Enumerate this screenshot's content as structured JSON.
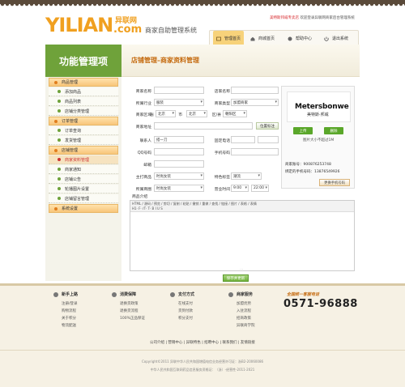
{
  "header": {
    "logo": "YILIAN",
    "logo_cn": "异联网",
    "logo_com": ".com",
    "system_name": "商家自助管理系统",
    "note_red": "美特斯邦威专卖店",
    "note": "欢迎登录异联网商家后台管理系统",
    "nav": [
      {
        "label": "管理首页",
        "icon": "home-gear-icon",
        "active": true
      },
      {
        "label": "商城首页",
        "icon": "house-icon",
        "active": false
      },
      {
        "label": "帮助中心",
        "icon": "help-icon",
        "active": false
      },
      {
        "label": "退出系统",
        "icon": "exit-icon",
        "active": false
      }
    ]
  },
  "sidebar": {
    "title": "功能管理项",
    "groups": [
      {
        "label": "商品管理",
        "items": [
          "添加商品",
          "商品列表",
          "店铺分类管理"
        ]
      },
      {
        "label": "订单管理",
        "items": [
          "订单查询",
          "发货管理"
        ]
      },
      {
        "label": "店铺管理",
        "items": [
          "商家资料管理",
          "商家通知",
          "店铺公告",
          "轮播图片设置",
          "店铺留言管理"
        ]
      },
      {
        "label": "系统设置",
        "items": []
      }
    ],
    "active_item": "商家资料管理"
  },
  "main": {
    "title": "店铺管理–商家资料管理",
    "form": {
      "merchant_name_label": "商家名称",
      "merchant_name": "",
      "shop_name_label": "店家名称",
      "shop_name": "",
      "industry_label": "所属行业",
      "industry": "服装",
      "type_label": "商家类型",
      "type": "加盟商家",
      "region_label": "商家区域",
      "province_label": "省",
      "province": "北京",
      "city_label": "市",
      "city": "北京",
      "district_label": "区/县",
      "district": "朝阳区",
      "address_label": "商家地址",
      "address": "",
      "locate_button": "位置标注",
      "contact_label": "联系人",
      "contact": "搭一刀",
      "phone_label": "固定电话",
      "phone": "",
      "qq_label": "QQ号码",
      "qq": "",
      "mobile_label": "手机号码",
      "mobile": "",
      "email_label": "邮箱",
      "email": "",
      "main_business_label": "主打商品",
      "main_business": "时尚女装",
      "special_label": "特色标签",
      "special": "潮流",
      "category_label": "所属商圈",
      "category": "时尚女装",
      "hours_label": "营业时间",
      "hours_start": "9:00",
      "hours_end": "22:00",
      "intro_label": "商品介绍"
    },
    "logo_panel": {
      "brand_text": "Metersbonwe",
      "brand_sub": "美特斯·邦威",
      "upload_button": "上传",
      "delete_button": "删除",
      "image_note": "图片大小不超过1M",
      "account_label": "商家账号：",
      "account": "900876253748",
      "bound_mobile_label": "绑定的手机号码：",
      "bound_mobile": "13876549926",
      "change_button": "更换手机号码"
    },
    "editor_row1": "HTML / 源码 / 预览 / 剪切 / 复制 / 粘贴 / 撤销 / 重做 / 查找 / 链接 / 图片 / 表格 / 表情",
    "editor_row2": "H1· F· rT· T·  B  I  U  S",
    "save_button": "保存并更新"
  },
  "footer": {
    "columns": [
      {
        "title": "新手上路",
        "icon": "newbie-icon",
        "items": [
          "注册/登录",
          "购物流程",
          "关于积分",
          "物流配送"
        ]
      },
      {
        "title": "消费保障",
        "icon": "shield-icon",
        "items": [
          "退换货政策",
          "退换货流程",
          "100%正品保证"
        ]
      },
      {
        "title": "支付方式",
        "icon": "card-icon",
        "items": [
          "在线支付",
          "货到付款",
          "积分支付"
        ]
      },
      {
        "title": "商家服务",
        "icon": "store-icon",
        "items": [
          "加盟优势",
          "入驻流程",
          "招商政策",
          "异联商学院"
        ]
      }
    ],
    "hotline_label": "全国统一客服电话",
    "hotline": "0571-96888",
    "links": "公司介绍 | 营销中心 | 异联特色 | 招聘中心 | 联系我们 | 友情链接",
    "copyright1": "Copyright©2011 异联中华人民共和国增值电信业务经营许可证：浙B2-20060086",
    "copyright2": "中华人民共和国互联网药品信息服务资格证：（浙）-经营性-2011-2021"
  }
}
